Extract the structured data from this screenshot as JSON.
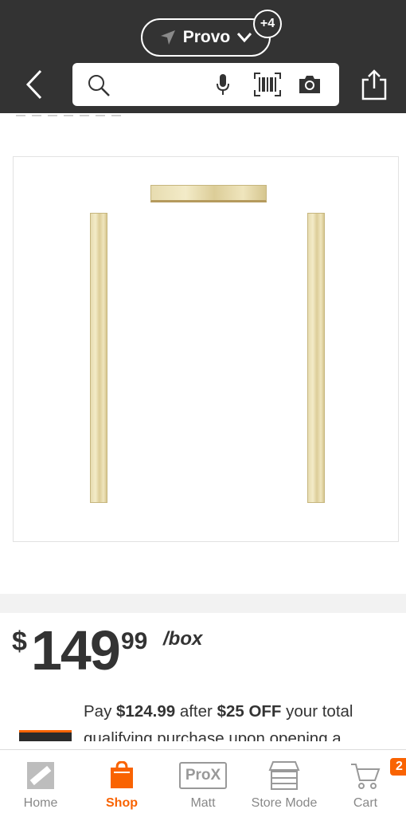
{
  "header": {
    "location_label": "Provo",
    "location_badge": "+4",
    "search_placeholder": ""
  },
  "product": {
    "image_icon": "door-frame-kit-image"
  },
  "price": {
    "dollar_sign": "$",
    "whole": "149",
    "cents": "99",
    "unit": "/box"
  },
  "promo": {
    "text_prefix": "Pay ",
    "discounted_price": "$124.99",
    "text_middle": " after ",
    "discount_amount": "$25 OFF",
    "text_suffix": " your total qualifying purchase upon opening a"
  },
  "bottom_nav": {
    "items": [
      {
        "label": "Home",
        "icon": "home-depot-logo-icon"
      },
      {
        "label": "Shop",
        "icon": "shop-bag-icon"
      },
      {
        "label": "Matt",
        "icon": "pro-x-icon"
      },
      {
        "label": "Store Mode",
        "icon": "store-icon"
      },
      {
        "label": "Cart",
        "icon": "cart-icon"
      }
    ],
    "pro_x_label": "ProX",
    "cart_count": "2"
  },
  "colors": {
    "header_bg": "#333333",
    "accent": "#f96302"
  }
}
